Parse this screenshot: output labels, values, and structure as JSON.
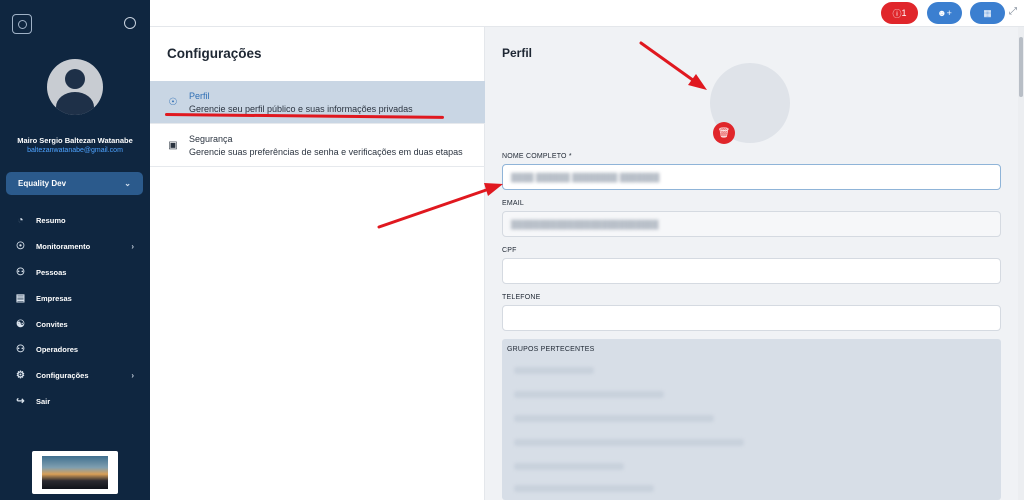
{
  "sidebar": {
    "user": {
      "name": "Mairo Sergio Baltezan Watanabe",
      "email": "baltezanwatanabe@gmail.com"
    },
    "organization": "Equality Dev",
    "items": [
      {
        "label": "Resumo",
        "icon": "pie-chart-icon",
        "has_submenu": false
      },
      {
        "label": "Monitoramento",
        "icon": "globe-icon",
        "has_submenu": true
      },
      {
        "label": "Pessoas",
        "icon": "people-icon",
        "has_submenu": false
      },
      {
        "label": "Empresas",
        "icon": "store-icon",
        "has_submenu": false
      },
      {
        "label": "Convites",
        "icon": "user-plus-icon",
        "has_submenu": false
      },
      {
        "label": "Operadores",
        "icon": "users-icon",
        "has_submenu": false
      },
      {
        "label": "Configurações",
        "icon": "gear-icon",
        "has_submenu": true
      },
      {
        "label": "Sair",
        "icon": "logout-icon",
        "has_submenu": false
      }
    ]
  },
  "topbar": {
    "alert_count": "1",
    "colors": {
      "alert": "#e0262b",
      "primary": "#3b7fd0"
    }
  },
  "settings": {
    "title": "Configurações",
    "items": [
      {
        "title": "Perfil",
        "description": "Gerencie seu perfil público e suas informações privadas",
        "icon": "user-circle-icon",
        "active": true
      },
      {
        "title": "Segurança",
        "description": "Gerencie suas preferências de senha e verificações em duas etapas",
        "icon": "lock-icon",
        "active": false
      }
    ]
  },
  "profile": {
    "title": "Perfil",
    "fields": {
      "full_name_label": "NOME COMPLETO *",
      "email_label": "EMAIL",
      "cpf_label": "CPF",
      "phone_label": "TELEFONE",
      "groups_label": "GRUPOS PERTECENTES"
    }
  },
  "annotation_color": "#e0181f"
}
